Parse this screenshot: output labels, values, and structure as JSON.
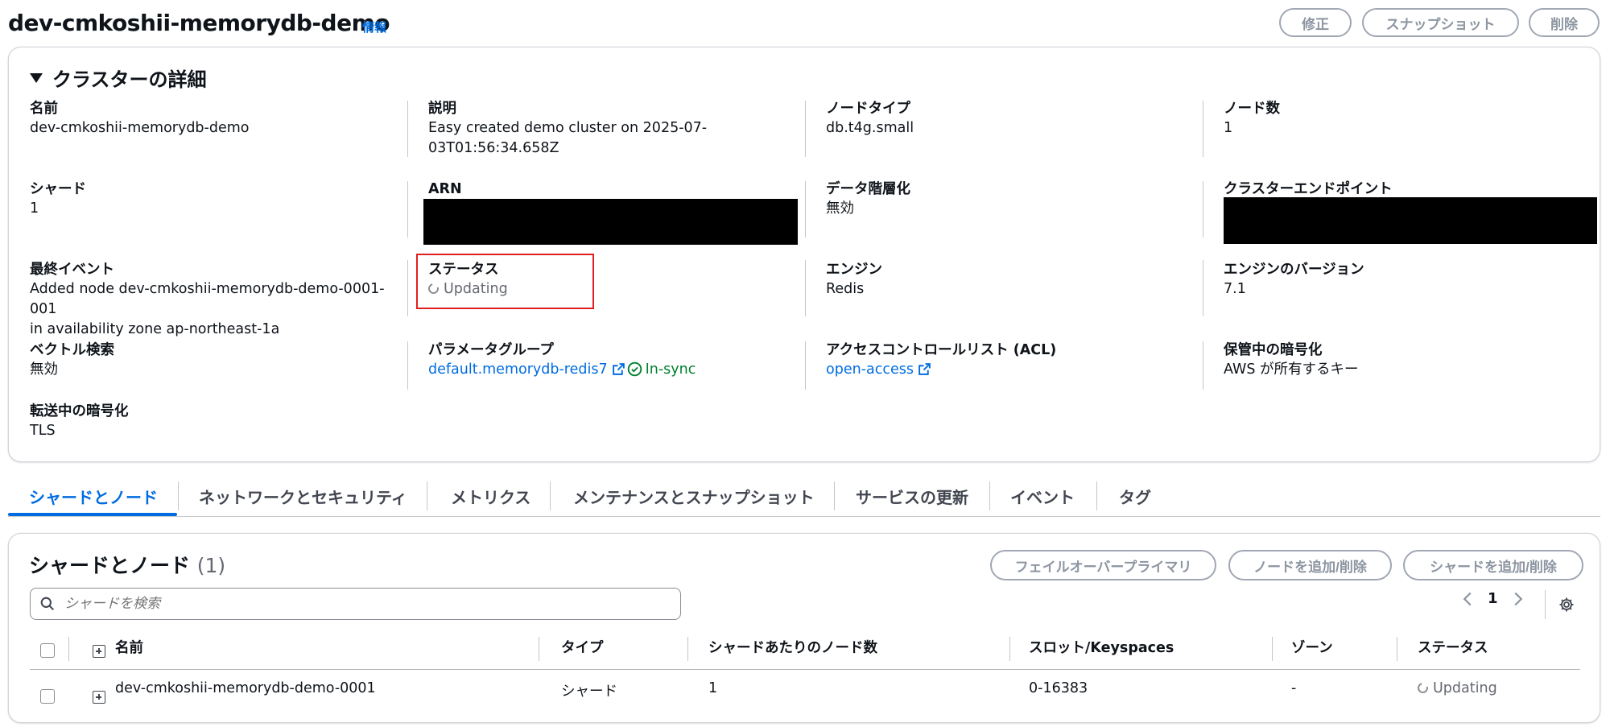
{
  "header": {
    "title": "dev-cmkoshii-memorydb-demo",
    "info_label": "情報",
    "buttons": {
      "modify": "修正",
      "snapshot": "スナップショット",
      "delete": "削除"
    }
  },
  "details": {
    "heading": "クラスターの詳細",
    "name": {
      "label": "名前",
      "value": "dev-cmkoshii-memorydb-demo"
    },
    "description": {
      "label": "説明",
      "value_line1": "Easy created demo cluster on 2025-07-",
      "value_line2": "03T01:56:34.658Z"
    },
    "node_type": {
      "label": "ノードタイプ",
      "value": "db.t4g.small"
    },
    "node_count": {
      "label": "ノード数",
      "value": "1"
    },
    "shards": {
      "label": "シャード",
      "value": "1"
    },
    "arn": {
      "label": "ARN"
    },
    "data_tiering": {
      "label": "データ階層化",
      "value": "無効"
    },
    "cluster_endpoint": {
      "label": "クラスターエンドポイント"
    },
    "last_event": {
      "label": "最終イベント",
      "value_line1": "Added node dev-cmkoshii-memorydb-demo-0001-001",
      "value_line2": "in availability zone ap-northeast-1a"
    },
    "status": {
      "label": "ステータス",
      "value": "Updating"
    },
    "engine": {
      "label": "エンジン",
      "value": "Redis"
    },
    "engine_version": {
      "label": "エンジンのバージョン",
      "value": "7.1"
    },
    "vector_search": {
      "label": "ベクトル検索",
      "value": "無効"
    },
    "parameter_group": {
      "label": "パラメータグループ",
      "value": "default.memorydb-redis7",
      "sync_status": "In-sync"
    },
    "acl": {
      "label": "アクセスコントロールリスト (ACL)",
      "value": "open-access"
    },
    "encryption_at_rest": {
      "label": "保管中の暗号化",
      "value": "AWS が所有するキー"
    },
    "encryption_in_transit": {
      "label": "転送中の暗号化",
      "value": "TLS"
    }
  },
  "tabs": [
    {
      "label": "シャードとノード"
    },
    {
      "label": "ネットワークとセキュリティ"
    },
    {
      "label": "メトリクス"
    },
    {
      "label": "メンテナンスとスナップショット"
    },
    {
      "label": "サービスの更新"
    },
    {
      "label": "イベント"
    },
    {
      "label": "タグ"
    }
  ],
  "shards_section": {
    "title": "シャードとノード",
    "count": "(1)",
    "buttons": {
      "failover": "フェイルオーバープライマリ",
      "add_remove_nodes": "ノードを追加/削除",
      "add_remove_shards": "シャードを追加/削除"
    },
    "search_placeholder": "シャードを検索",
    "page": "1",
    "columns": [
      "名前",
      "タイプ",
      "シャードあたりのノード数",
      "スロット/Keyspaces",
      "ゾーン",
      "ステータス"
    ],
    "rows": [
      {
        "name": "dev-cmkoshii-memorydb-demo-0001",
        "type": "シャード",
        "nodes_per_shard": "1",
        "slots": "0-16383",
        "zone": "-",
        "status": "Updating"
      }
    ]
  },
  "colors": {
    "accent": "#006ce0",
    "success": "#00802f",
    "highlight_border": "#e02020"
  }
}
